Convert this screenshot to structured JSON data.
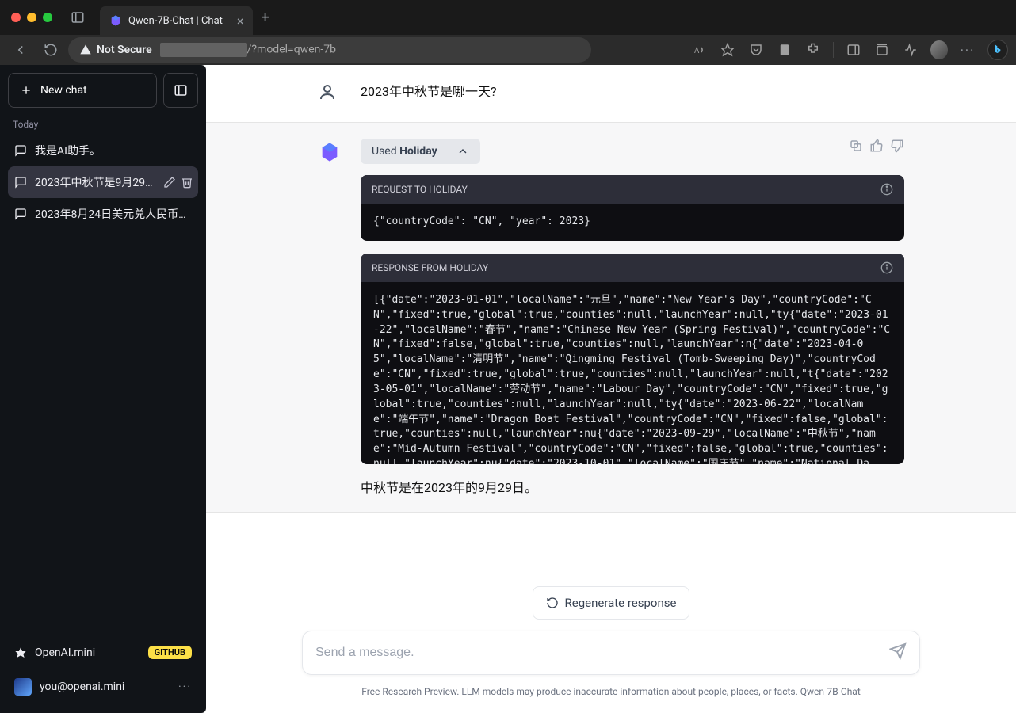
{
  "browser": {
    "tab_title": "Qwen-7B-Chat | Chat",
    "not_secure_label": "Not Secure",
    "url_path": "/?model=qwen-7b"
  },
  "sidebar": {
    "new_chat_label": "New chat",
    "section_today": "Today",
    "conversations": [
      {
        "label": "我是AI助手。"
      },
      {
        "label": "2023年中秋节是9月29…"
      },
      {
        "label": "2023年8月24日美元兑人民币…"
      }
    ],
    "openai_mini_label": "OpenAI.mini",
    "github_badge": "GITHUB",
    "user_email": "you@openai.mini"
  },
  "chat": {
    "user_message": "2023年中秋节是哪一天?",
    "tool_chip_prefix": "Used ",
    "tool_chip_name": "Holiday",
    "request_header": "REQUEST TO HOLIDAY",
    "request_body": "{\"countryCode\": \"CN\", \"year\": 2023}",
    "response_header": "RESPONSE FROM HOLIDAY",
    "response_body": "[{\"date\":\"2023-01-01\",\"localName\":\"元旦\",\"name\":\"New Year's Day\",\"countryCode\":\"CN\",\"fixed\":true,\"global\":true,\"counties\":null,\"launchYear\":null,\"ty{\"date\":\"2023-01-22\",\"localName\":\"春节\",\"name\":\"Chinese New Year (Spring Festival)\",\"countryCode\":\"CN\",\"fixed\":false,\"global\":true,\"counties\":null,\"launchYear\":n{\"date\":\"2023-04-05\",\"localName\":\"清明节\",\"name\":\"Qingming Festival (Tomb-Sweeping Day)\",\"countryCode\":\"CN\",\"fixed\":true,\"global\":true,\"counties\":null,\"launchYear\":null,\"t{\"date\":\"2023-05-01\",\"localName\":\"劳动节\",\"name\":\"Labour Day\",\"countryCode\":\"CN\",\"fixed\":true,\"global\":true,\"counties\":null,\"launchYear\":null,\"ty{\"date\":\"2023-06-22\",\"localName\":\"端午节\",\"name\":\"Dragon Boat Festival\",\"countryCode\":\"CN\",\"fixed\":false,\"global\":true,\"counties\":null,\"launchYear\":nu{\"date\":\"2023-09-29\",\"localName\":\"中秋节\",\"name\":\"Mid-Autumn Festival\",\"countryCode\":\"CN\",\"fixed\":false,\"global\":true,\"counties\":null,\"launchYear\":nu{\"date\":\"2023-10-01\",\"localName\":\"国庆节\",\"name\":\"National Day\",\"countryCode\":\"CN\",\"fixed\":true,\"global\":true,\"counties\":null,\"launchYear\":null,\"ty",
    "answer_text": "中秋节是在2023年的9月29日。"
  },
  "composer": {
    "regenerate_label": "Regenerate response",
    "placeholder": "Send a message.",
    "footer_text": "Free Research Preview. LLM models may produce inaccurate information about people, places, or facts. ",
    "footer_link": "Qwen-7B-Chat"
  }
}
